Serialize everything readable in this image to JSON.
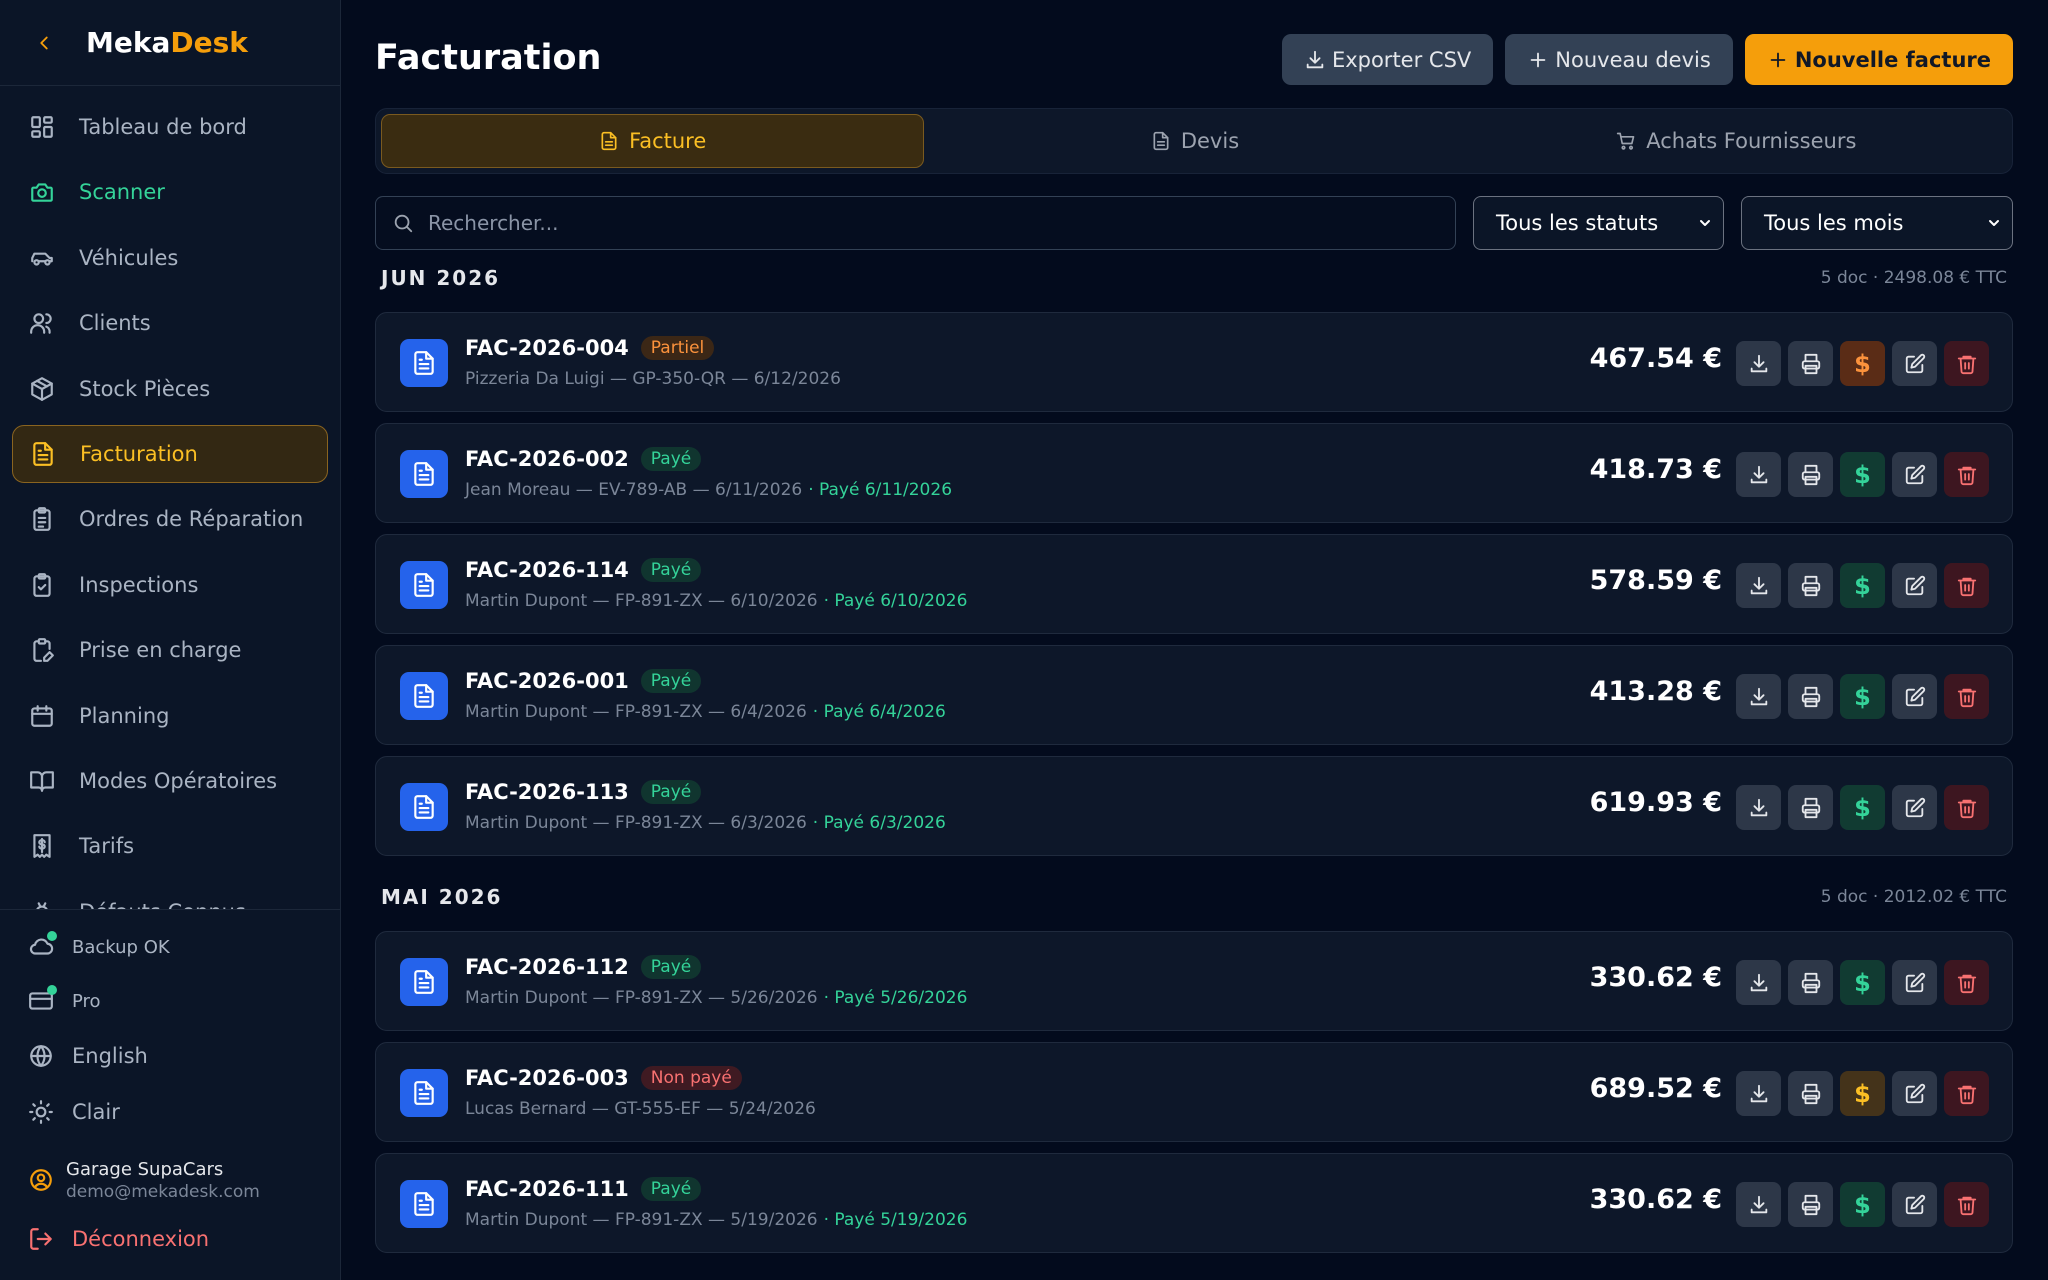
{
  "app": {
    "logo_part1": "Meka",
    "logo_part2": "Desk"
  },
  "colors": {
    "accent": "#f59e0b",
    "success": "#34d399",
    "danger": "#f87171",
    "partial": "#fb923c",
    "doc_icon": "#2563eb"
  },
  "sidebar": {
    "nav": [
      {
        "label": "Tableau de bord",
        "icon": "dashboard-icon"
      },
      {
        "label": "Scanner",
        "icon": "camera-icon"
      },
      {
        "label": "Véhicules",
        "icon": "car-icon"
      },
      {
        "label": "Clients",
        "icon": "users-icon"
      },
      {
        "label": "Stock Pièces",
        "icon": "package-icon"
      },
      {
        "label": "Facturation",
        "icon": "invoice-icon"
      },
      {
        "label": "Ordres de Réparation",
        "icon": "clipboard-icon"
      },
      {
        "label": "Inspections",
        "icon": "clipboard-check-icon"
      },
      {
        "label": "Prise en charge",
        "icon": "clipboard-pen-icon"
      },
      {
        "label": "Planning",
        "icon": "calendar-icon"
      },
      {
        "label": "Modes Opératoires",
        "icon": "book-icon"
      },
      {
        "label": "Tarifs",
        "icon": "receipt-dollar-icon"
      },
      {
        "label": "Défauts Connus",
        "icon": "bug-icon"
      }
    ],
    "status": {
      "backup": "Backup OK",
      "plan": "Pro",
      "language": "English",
      "theme": "Clair"
    },
    "user": {
      "name": "Garage SupaCars",
      "email": "demo@mekadesk.com"
    },
    "logout": "Déconnexion"
  },
  "header": {
    "title": "Facturation",
    "export_label": "Exporter CSV",
    "new_quote_label": "Nouveau devis",
    "new_invoice_label": "Nouvelle facture"
  },
  "tabs": [
    "Facture",
    "Devis",
    "Achats Fournisseurs"
  ],
  "filters": {
    "search_placeholder": "Rechercher...",
    "status_selected": "Tous les statuts",
    "month_selected": "Tous les mois"
  },
  "groups": [
    {
      "title": "JUN 2026",
      "summary": "5 doc · 2498.08 € TTC",
      "invoices": [
        {
          "number": "FAC-2026-004",
          "status": "Partiel",
          "status_type": "partiel",
          "details": "Pizzeria Da Luigi — GP-350-QR — 6/12/2026",
          "paid": "",
          "amount": "467.54 €"
        },
        {
          "number": "FAC-2026-002",
          "status": "Payé",
          "status_type": "paye",
          "details": "Jean Moreau — EV-789-AB — 6/11/2026",
          "paid": "· Payé 6/11/2026",
          "amount": "418.73 €"
        },
        {
          "number": "FAC-2026-114",
          "status": "Payé",
          "status_type": "paye",
          "details": "Martin Dupont — FP-891-ZX — 6/10/2026",
          "paid": "· Payé 6/10/2026",
          "amount": "578.59 €"
        },
        {
          "number": "FAC-2026-001",
          "status": "Payé",
          "status_type": "paye",
          "details": "Martin Dupont — FP-891-ZX — 6/4/2026",
          "paid": "· Payé 6/4/2026",
          "amount": "413.28 €"
        },
        {
          "number": "FAC-2026-113",
          "status": "Payé",
          "status_type": "paye",
          "details": "Martin Dupont — FP-891-ZX — 6/3/2026",
          "paid": "· Payé 6/3/2026",
          "amount": "619.93 €"
        }
      ]
    },
    {
      "title": "MAI 2026",
      "summary": "5 doc · 2012.02 € TTC",
      "invoices": [
        {
          "number": "FAC-2026-112",
          "status": "Payé",
          "status_type": "paye",
          "details": "Martin Dupont — FP-891-ZX — 5/26/2026",
          "paid": "· Payé 5/26/2026",
          "amount": "330.62 €"
        },
        {
          "number": "FAC-2026-003",
          "status": "Non payé",
          "status_type": "nonpaye",
          "details": "Lucas Bernard — GT-555-EF — 5/24/2026",
          "paid": "",
          "amount": "689.52 €"
        },
        {
          "number": "FAC-2026-111",
          "status": "Payé",
          "status_type": "paye",
          "details": "Martin Dupont — FP-891-ZX — 5/19/2026",
          "paid": "· Payé 5/19/2026",
          "amount": "330.62 €"
        }
      ]
    }
  ]
}
